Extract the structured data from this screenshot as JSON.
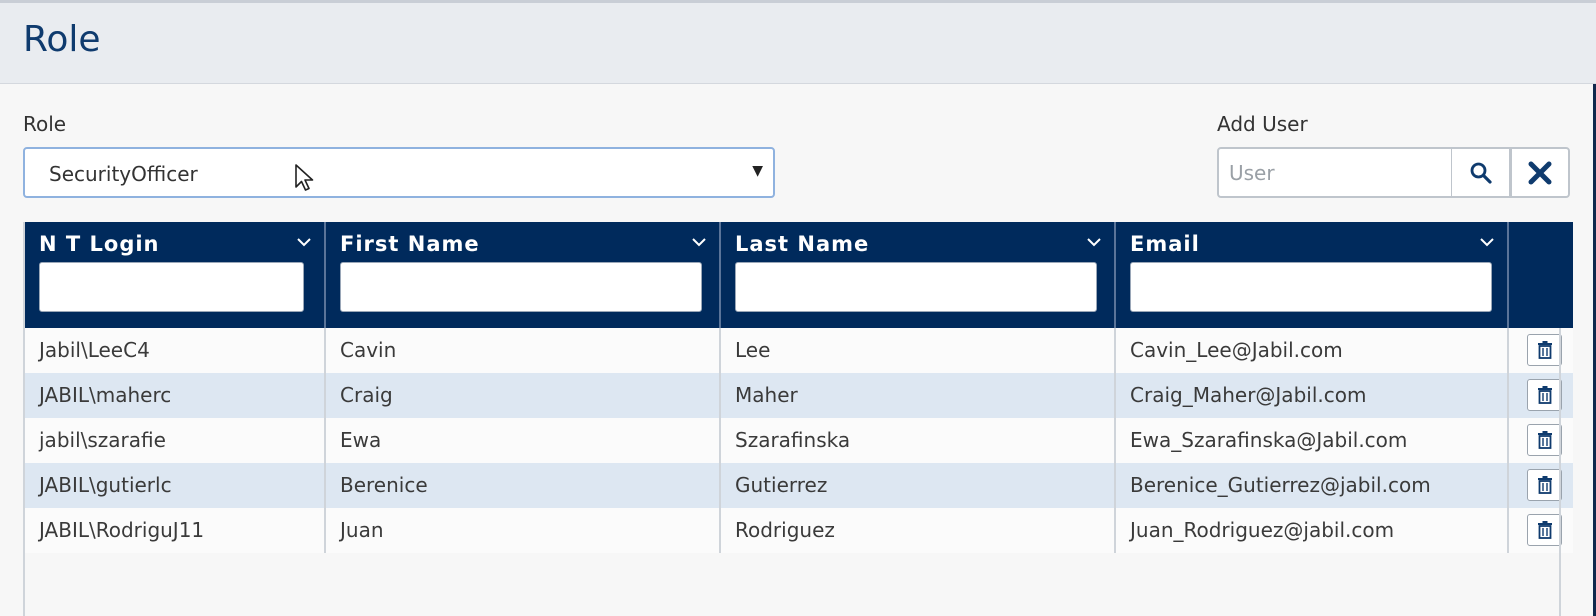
{
  "header": {
    "title": "Role"
  },
  "role_field": {
    "label": "Role",
    "selected": "SecurityOfficer"
  },
  "add_user": {
    "label": "Add User",
    "placeholder": "User"
  },
  "grid": {
    "columns": [
      {
        "label": "N T Login"
      },
      {
        "label": "First Name"
      },
      {
        "label": "Last Name"
      },
      {
        "label": "Email"
      }
    ],
    "rows": [
      {
        "login": "Jabil\\LeeC4",
        "first": "Cavin",
        "last": "Lee",
        "email": "Cavin_Lee@Jabil.com"
      },
      {
        "login": "JABIL\\maherc",
        "first": "Craig",
        "last": "Maher",
        "email": "Craig_Maher@Jabil.com"
      },
      {
        "login": "jabil\\szarafie",
        "first": "Ewa",
        "last": "Szarafinska",
        "email": "Ewa_Szarafinska@Jabil.com"
      },
      {
        "login": "JABIL\\gutierlc",
        "first": "Berenice",
        "last": "Gutierrez",
        "email": "Berenice_Gutierrez@jabil.com"
      },
      {
        "login": "JABIL\\RodriguJ11",
        "first": "Juan",
        "last": "Rodriguez",
        "email": "Juan_Rodriguez@jabil.com"
      }
    ]
  },
  "colors": {
    "header_band": "#e9ecf0",
    "title": "#0f3b6e",
    "grid_header": "#002a5c",
    "row_alt": "#dde7f2",
    "icon": "#0f3b6e"
  },
  "icons": {
    "search": "search-icon",
    "clear": "close-icon",
    "column_menu": "chevron-down-icon",
    "row_delete": "trash-icon",
    "select_arrow": "caret-down-icon"
  }
}
